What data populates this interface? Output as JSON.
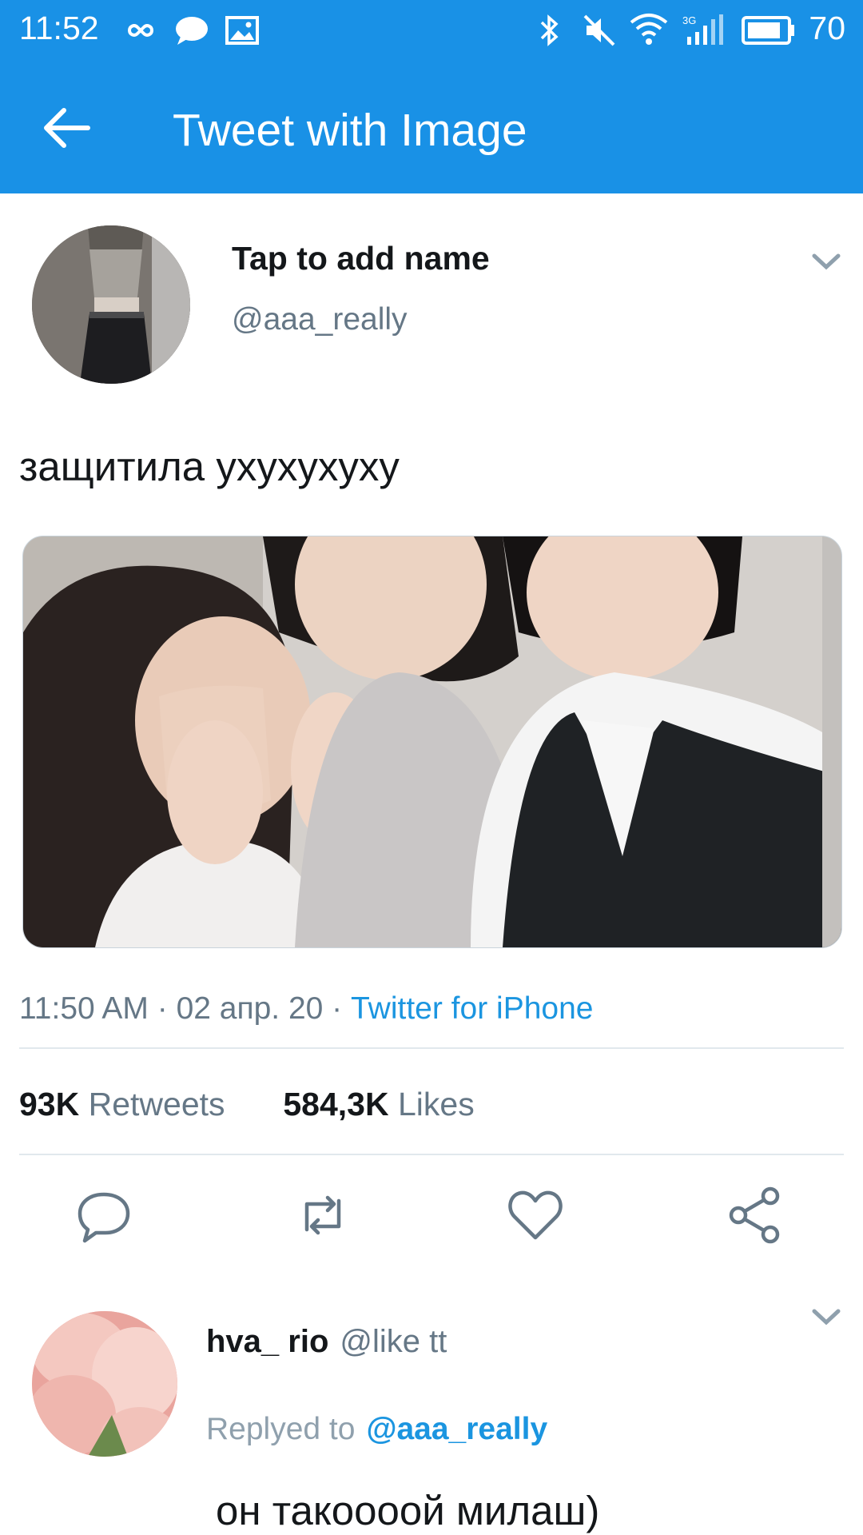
{
  "status_bar": {
    "time": "11:52",
    "battery_percent": "70",
    "icons": [
      "infinity-icon",
      "message-icon",
      "gallery-icon",
      "bluetooth-icon",
      "mute-icon",
      "wifi-icon",
      "signal-3g-icon",
      "battery-icon"
    ]
  },
  "app_bar": {
    "title": "Tweet with Image",
    "back_icon": "arrow-left-icon",
    "color": "#1991e6"
  },
  "tweet": {
    "author_name": "Tap to add name",
    "author_handle": "@aaa_really",
    "text": "защитила ухухухуху",
    "time": "11:50 AM",
    "date": "02 апр. 20",
    "source": "Twitter for iPhone",
    "separator": " · ",
    "retweets_count": "93K",
    "retweets_label": "Retweets",
    "likes_count": "584,3K",
    "likes_label": "Likes"
  },
  "actions": [
    {
      "name": "reply",
      "icon": "comment-icon"
    },
    {
      "name": "retweet",
      "icon": "retweet-icon"
    },
    {
      "name": "like",
      "icon": "heart-icon"
    },
    {
      "name": "share",
      "icon": "share-icon"
    }
  ],
  "reply": {
    "name": "hva_ rio",
    "handle": "@like tt",
    "replied_label": "Replyed to",
    "replied_to": "@aaa_really",
    "text": "он такоооой милаш)"
  },
  "colors": {
    "accent": "#1b95e0",
    "muted": "#657786",
    "divider": "#e1e8ed"
  }
}
